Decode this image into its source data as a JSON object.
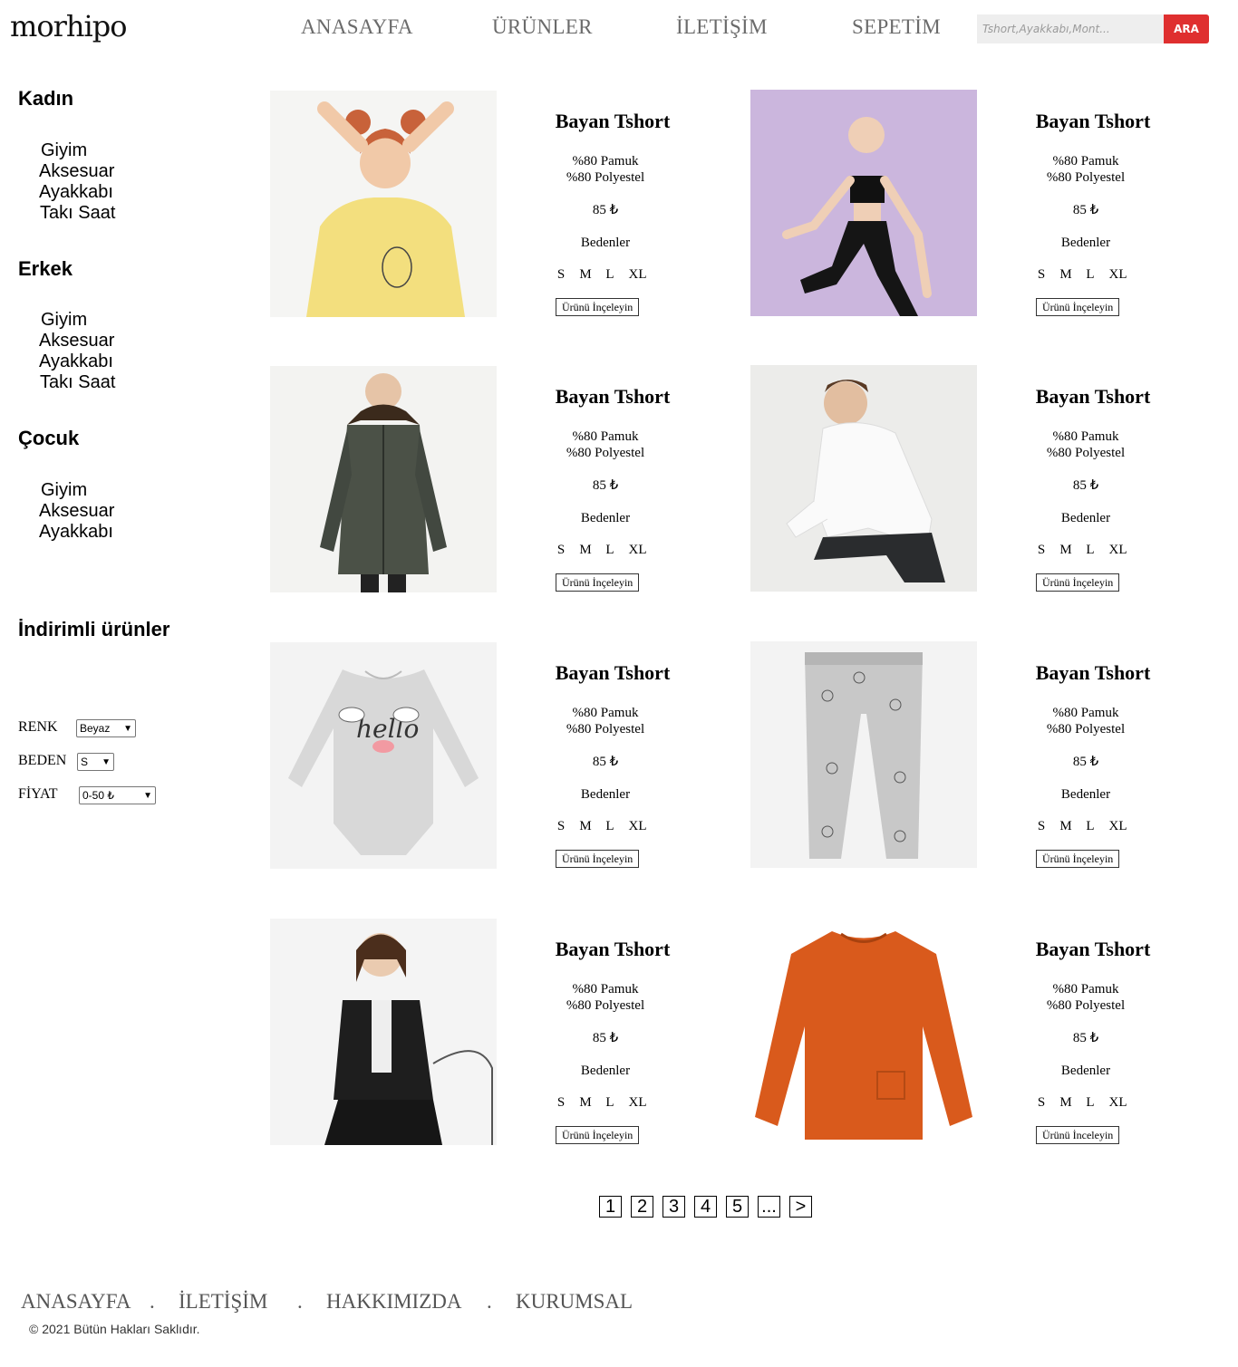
{
  "header": {
    "logo": "morhipo",
    "nav": [
      "ANASAYFA",
      "ÜRÜNLER",
      "İLETİŞİM",
      "SEPETİM"
    ],
    "search_placeholder": "Tshort,Ayakkabı,Mont...",
    "search_button": "ARA"
  },
  "sidebar": {
    "kadin": {
      "title": "Kadın",
      "items": [
        "Giyim",
        "Aksesuar",
        "Ayakkabı",
        "Takı Saat"
      ]
    },
    "erkek": {
      "title": "Erkek",
      "items": [
        "Giyim",
        "Aksesuar",
        "Ayakkabı",
        "Takı Saat"
      ]
    },
    "cocuk": {
      "title": "Çocuk",
      "items": [
        "Giyim",
        "Aksesuar",
        "Ayakkabı"
      ]
    },
    "discount_title": "İndirimli ürünler",
    "filters": {
      "color_label": "RENK",
      "color_value": "Beyaz",
      "size_label": "BEDEN",
      "size_value": "S",
      "price_label": "FİYAT",
      "price_value": "0-50 ₺"
    }
  },
  "products": [
    {
      "title": "Bayan Tshort",
      "line1": "%80 Pamuk",
      "line2": "%80 Polyestel",
      "price": "85 ₺",
      "sizes_label": "Bedenler",
      "sizes": [
        "S",
        "M",
        "L",
        "XL"
      ],
      "button": "Ürünü İnçeleyin",
      "image": "woman-yellow-tshirt"
    },
    {
      "title": "Bayan Tshort",
      "line1": "%80 Pamuk",
      "line2": "%80 Polyestel",
      "price": "85 ₺",
      "sizes_label": "Bedenler",
      "sizes": [
        "S",
        "M",
        "L",
        "XL"
      ],
      "button": "Ürünü İnçeleyin",
      "image": "woman-black-sportswear"
    },
    {
      "title": "Bayan Tshort",
      "line1": "%80 Pamuk",
      "line2": "%80 Polyestel",
      "price": "85 ₺",
      "sizes_label": "Bedenler",
      "sizes": [
        "S",
        "M",
        "L",
        "XL"
      ],
      "button": "Ürünü İnçeleyin",
      "image": "man-green-parka"
    },
    {
      "title": "Bayan Tshort",
      "line1": "%80 Pamuk",
      "line2": "%80 Polyestel",
      "price": "85 ₺",
      "sizes_label": "Bedenler",
      "sizes": [
        "S",
        "M",
        "L",
        "XL"
      ],
      "button": "Ürünü İnçeleyin",
      "image": "man-white-hoodie"
    },
    {
      "title": "Bayan Tshort",
      "line1": "%80 Pamuk",
      "line2": "%80 Polyestel",
      "price": "85 ₺",
      "sizes_label": "Bedenler",
      "sizes": [
        "S",
        "M",
        "L",
        "XL"
      ],
      "button": "Ürünü İnçeleyin",
      "image": "baby-grey-bodysuit"
    },
    {
      "title": "Bayan Tshort",
      "line1": "%80 Pamuk",
      "line2": "%80 Polyestel",
      "price": "85 ₺",
      "sizes_label": "Bedenler",
      "sizes": [
        "S",
        "M",
        "L",
        "XL"
      ],
      "button": "Ürünü İnçeleyin",
      "image": "kids-grey-leggings"
    },
    {
      "title": "Bayan Tshort",
      "line1": "%80 Pamuk",
      "line2": "%80 Polyestel",
      "price": "85 ₺",
      "sizes_label": "Bedenler",
      "sizes": [
        "S",
        "M",
        "L",
        "XL"
      ],
      "button": "Ürünü İnçeleyin",
      "image": "woman-black-jacket"
    },
    {
      "title": "Bayan Tshort",
      "line1": "%80 Pamuk",
      "line2": "%80 Polyestel",
      "price": "85 ₺",
      "sizes_label": "Bedenler",
      "sizes": [
        "S",
        "M",
        "L",
        "XL"
      ],
      "button": "Ürünü İnceleyin",
      "image": "kids-orange-sweater"
    }
  ],
  "pagination": [
    "1",
    "2",
    "3",
    "4",
    "5",
    "...",
    ">"
  ],
  "footer": {
    "links": [
      "ANASAYFA",
      "İLETİŞİM",
      "HAKKIMIZDA",
      "KURUMSAL"
    ],
    "separator": ".",
    "copyright": "© 2021 Bütün Hakları Saklıdır."
  },
  "colors": {
    "accent": "#df2f2f",
    "nav_text": "#6b6b6b"
  }
}
